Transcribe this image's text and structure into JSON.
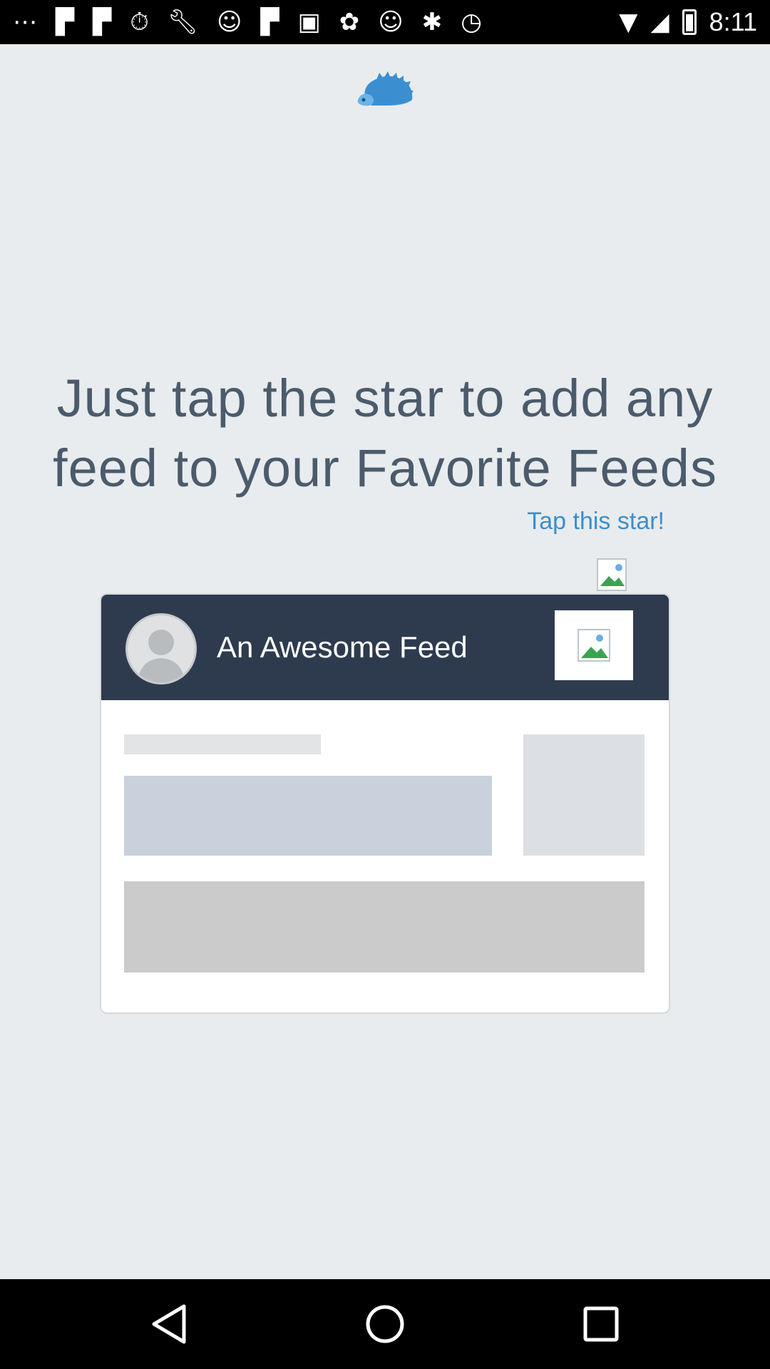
{
  "status_bar": {
    "time": "8:11",
    "left_icons": [
      "more-icon",
      "flipboard-icon",
      "flipboard-icon",
      "stopwatch-icon",
      "wrench-icon",
      "smiley-icon",
      "flipboard-icon",
      "qt-icon",
      "tsum-icon",
      "smiley-icon",
      "bluetooth-icon",
      "alarm-icon"
    ],
    "right_icons": [
      "wifi-icon",
      "signal-icon",
      "battery-icon"
    ]
  },
  "onboarding": {
    "headline_line1": "Just tap the star to add any",
    "headline_line2": "feed to your Favorite Feeds",
    "hint": "Tap this star!"
  },
  "feed_card": {
    "title": "An Awesome Feed"
  },
  "nav_bar": {
    "back": "back-icon",
    "home": "home-icon",
    "recents": "recents-icon"
  },
  "colors": {
    "background": "#e8ecef",
    "headline": "#4b5b6b",
    "hint": "#3d8ec9",
    "card_header": "#2e3b4e"
  }
}
